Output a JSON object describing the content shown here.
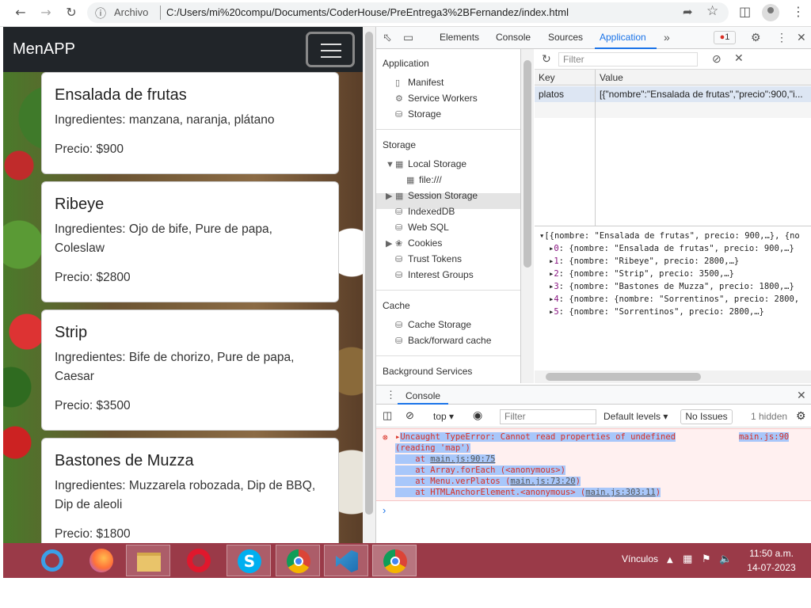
{
  "browser": {
    "info_label": "Archivo",
    "url": "C:/Users/mi%20compu/Documents/CoderHouse/PreEntrega3%2BFernandez/index.html"
  },
  "page": {
    "brand": "MenAPP",
    "cards": [
      {
        "title": "Ensalada de frutas",
        "ingredients": "Ingredientes: manzana, naranja, plátano",
        "price": "Precio: $900"
      },
      {
        "title": "Ribeye",
        "ingredients": "Ingredientes: Ojo de bife, Pure de papa, Coleslaw",
        "price": "Precio: $2800"
      },
      {
        "title": "Strip",
        "ingredients": "Ingredientes: Bife de chorizo, Pure de papa, Caesar",
        "price": "Precio: $3500"
      },
      {
        "title": "Bastones de Muzza",
        "ingredients": "Ingredientes: Muzzarela robozada, Dip de BBQ, Dip de aleoli",
        "price": "Precio: $1800"
      }
    ]
  },
  "devtools": {
    "tabs": [
      "Elements",
      "Console",
      "Sources",
      "Application"
    ],
    "error_count": "1",
    "sidebar": {
      "application_header": "Application",
      "application_items": [
        "Manifest",
        "Service Workers",
        "Storage"
      ],
      "storage_header": "Storage",
      "local_storage": "Local Storage",
      "file_item": "file:///",
      "storage_items": [
        "Session Storage",
        "IndexedDB",
        "Web SQL",
        "Cookies",
        "Trust Tokens",
        "Interest Groups"
      ],
      "cache_header": "Cache",
      "cache_items": [
        "Cache Storage",
        "Back/forward cache"
      ],
      "background_header": "Background Services"
    },
    "filter_placeholder": "Filter",
    "table": {
      "key_header": "Key",
      "value_header": "Value",
      "key": "platos",
      "value": "[{\"nombre\":\"Ensalada de frutas\",\"precio\":900,\"i..."
    },
    "tree": {
      "root": "[{nombre: \"Ensalada de frutas\", precio: 900,…}, {no",
      "items": [
        {
          "index": "0",
          "text": "{nombre: \"Ensalada de frutas\", precio: 900,…}"
        },
        {
          "index": "1",
          "text": "{nombre: \"Ribeye\", precio: 2800,…}"
        },
        {
          "index": "2",
          "text": "{nombre: \"Strip\", precio: 3500,…}"
        },
        {
          "index": "3",
          "text": "{nombre: \"Bastones de Muzza\", precio: 1800,…}"
        },
        {
          "index": "4",
          "text": "{nombre: {nombre: \"Sorrentinos\", precio: 2800,"
        },
        {
          "index": "5",
          "text": "{nombre: \"Sorrentinos\", precio: 2800,…}"
        }
      ]
    },
    "console": {
      "title": "Console",
      "context": "top",
      "filter_placeholder": "Filter",
      "levels": "Default levels",
      "no_issues": "No Issues",
      "hidden": "1 hidden",
      "error_line1": "Uncaught TypeError: Cannot read properties of undefined",
      "error_source": "main.js:90",
      "error_line2": "(reading 'map')",
      "stack": [
        {
          "prefix": "    at ",
          "link": "main.js:90:75",
          "suffix": ""
        },
        {
          "prefix": "    at Array.forEach (<anonymous>)",
          "link": "",
          "suffix": ""
        },
        {
          "prefix": "    at Menu.verPlatos (",
          "link": "main.js:73:20",
          "suffix": ")"
        },
        {
          "prefix": "    at HTMLAnchorElement.<anonymous> (",
          "link": "main.js:303:11",
          "suffix": ")"
        }
      ]
    }
  },
  "taskbar": {
    "links_label": "Vínculos",
    "time": "11:50 a.m.",
    "date": "14-07-2023"
  }
}
